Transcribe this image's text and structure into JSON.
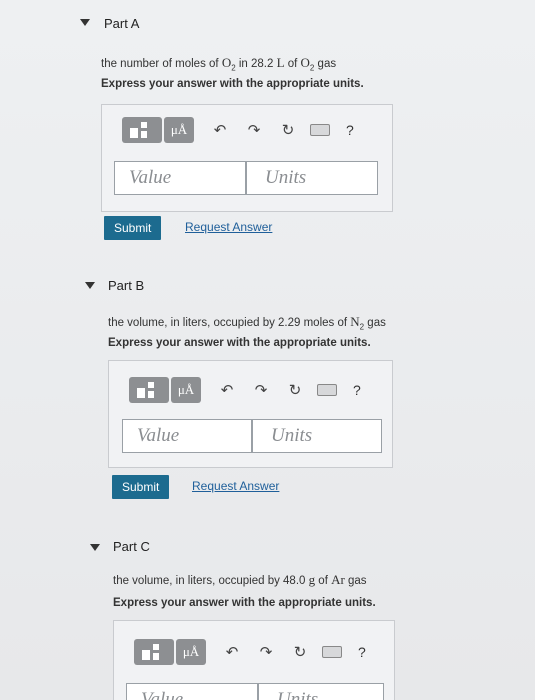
{
  "parts": [
    {
      "title": "Part A",
      "question_prefix": "the number of moles of ",
      "question_chem1": "O",
      "question_chem1_sub": "2",
      "question_mid": " in 28.2 ",
      "question_unit": "L",
      "question_mid2": " of ",
      "question_chem2": "O",
      "question_chem2_sub": "2",
      "question_suffix": " gas",
      "instruction": "Express your answer with the appropriate units.",
      "value_placeholder": "Value",
      "units_placeholder": "Units",
      "submit_label": "Submit",
      "request_label": "Request Answer"
    },
    {
      "title": "Part B",
      "question_prefix": "the volume, in liters, occupied by 2.29 moles of ",
      "question_chem1": "N",
      "question_chem1_sub": "2",
      "question_suffix": " gas",
      "instruction": "Express your answer with the appropriate units.",
      "value_placeholder": "Value",
      "units_placeholder": "Units",
      "submit_label": "Submit",
      "request_label": "Request Answer"
    },
    {
      "title": "Part C",
      "question_prefix": "the volume, in liters, occupied by 48.0 ",
      "question_unit": "g",
      "question_mid": " of ",
      "question_chem1": "Ar",
      "question_suffix": " gas",
      "instruction": "Express your answer with the appropriate units.",
      "value_placeholder": "Value",
      "units_placeholder": "Units"
    }
  ],
  "toolbar": {
    "mu_label": "μÅ",
    "undo_glyph": "↶",
    "redo_glyph": "↷",
    "reset_glyph": "↻",
    "help_glyph": "?"
  }
}
